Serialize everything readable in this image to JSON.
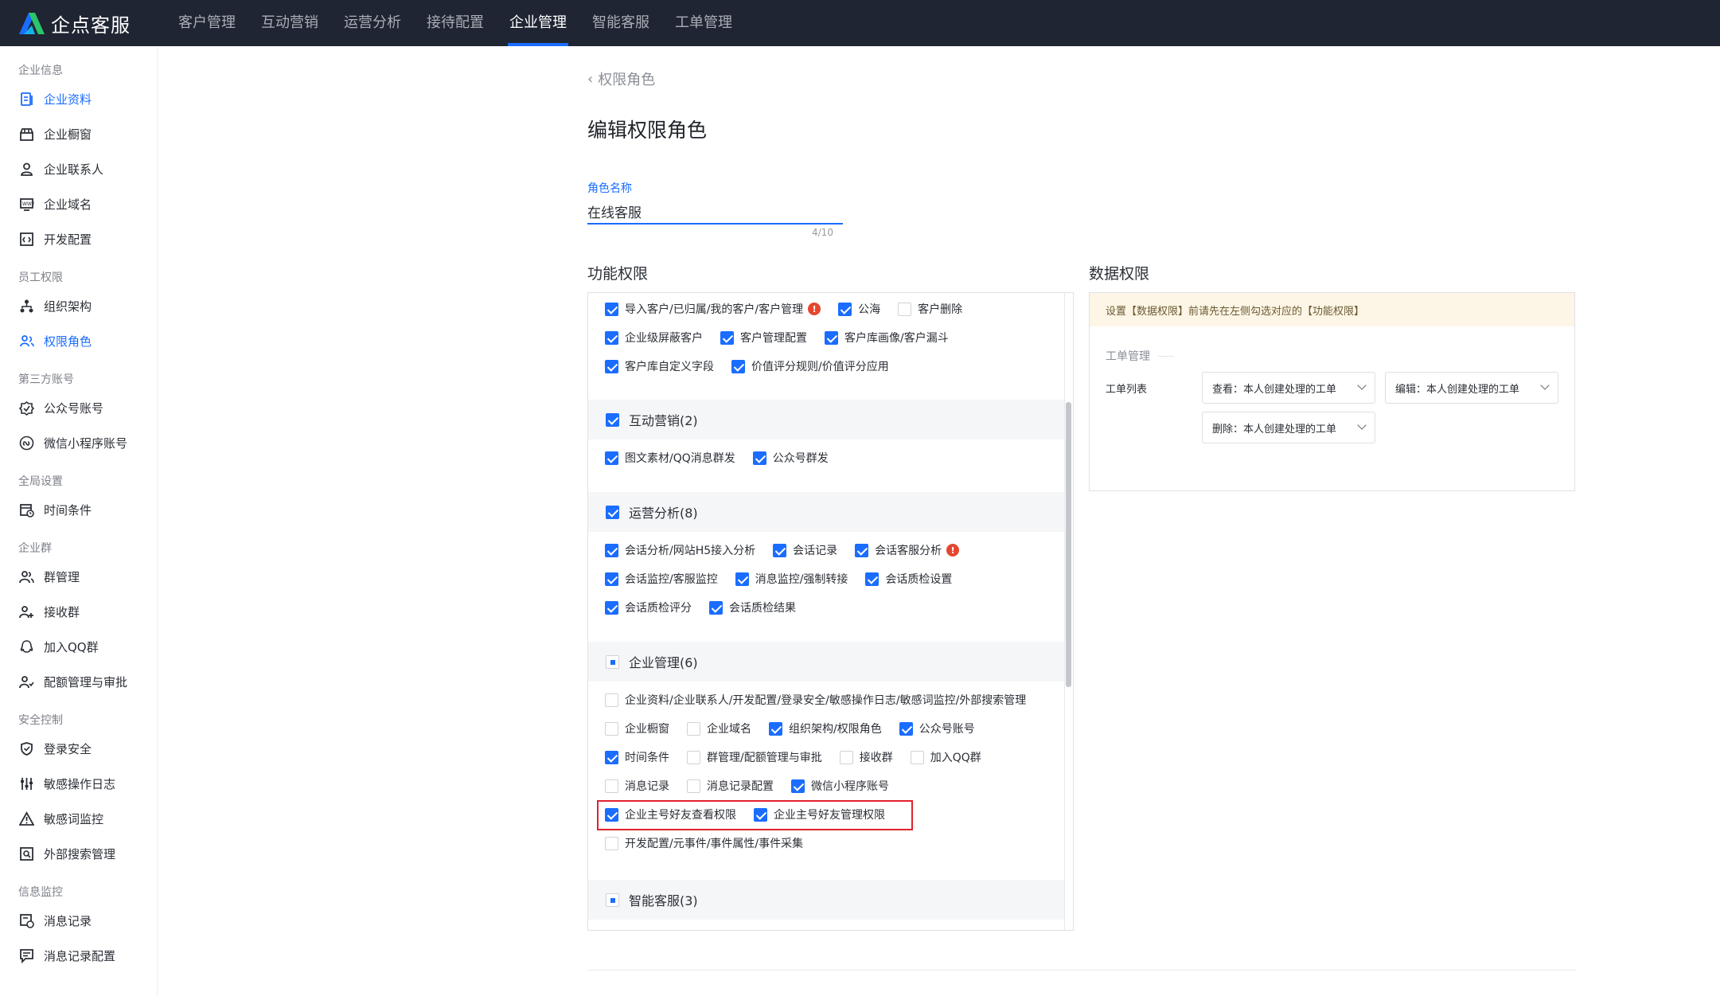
{
  "app": {
    "title": "企点客服"
  },
  "nav": [
    {
      "label": "客户管理",
      "active": false
    },
    {
      "label": "互动营销",
      "active": false
    },
    {
      "label": "运营分析",
      "active": false
    },
    {
      "label": "接待配置",
      "active": false
    },
    {
      "label": "企业管理",
      "active": true
    },
    {
      "label": "智能客服",
      "active": false
    },
    {
      "label": "工单管理",
      "active": false
    }
  ],
  "sidebar": {
    "groups": [
      {
        "title": "企业信息",
        "items": [
          {
            "label": "企业资料",
            "icon": "document-icon",
            "active": true
          },
          {
            "label": "企业橱窗",
            "icon": "store-icon"
          },
          {
            "label": "企业联系人",
            "icon": "contact-icon"
          },
          {
            "label": "企业域名",
            "icon": "domain-icon"
          },
          {
            "label": "开发配置",
            "icon": "code-icon"
          }
        ]
      },
      {
        "title": "员工权限",
        "items": [
          {
            "label": "组织架构",
            "icon": "org-chart-icon"
          },
          {
            "label": "权限角色",
            "icon": "role-icon",
            "active": true
          }
        ]
      },
      {
        "title": "第三方账号",
        "items": [
          {
            "label": "公众号账号",
            "icon": "official-account-icon"
          },
          {
            "label": "微信小程序账号",
            "icon": "mini-program-icon"
          }
        ]
      },
      {
        "title": "全局设置",
        "items": [
          {
            "label": "时间条件",
            "icon": "calendar-icon"
          }
        ]
      },
      {
        "title": "企业群",
        "items": [
          {
            "label": "群管理",
            "icon": "group-icon"
          },
          {
            "label": "接收群",
            "icon": "group-add-icon"
          },
          {
            "label": "加入QQ群",
            "icon": "qq-icon"
          },
          {
            "label": "配额管理与审批",
            "icon": "quota-icon"
          }
        ]
      },
      {
        "title": "安全控制",
        "items": [
          {
            "label": "登录安全",
            "icon": "shield-icon"
          },
          {
            "label": "敏感操作日志",
            "icon": "sliders-icon"
          },
          {
            "label": "敏感词监控",
            "icon": "warning-icon"
          },
          {
            "label": "外部搜索管理",
            "icon": "search-box-icon"
          }
        ]
      },
      {
        "title": "信息监控",
        "items": [
          {
            "label": "消息记录",
            "icon": "message-record-icon"
          },
          {
            "label": "消息记录配置",
            "icon": "message-config-icon"
          }
        ]
      }
    ]
  },
  "main": {
    "back_label": "权限角色",
    "page_title": "编辑权限角色",
    "role_name_label": "角色名称",
    "role_name_value": "在线客服",
    "role_name_count": "4/10",
    "func_title": "功能权限",
    "data_title": "数据权限"
  },
  "func": {
    "top_rows": [
      [
        {
          "label": "导入客户/已归属/我的客户/客户管理",
          "checked": true,
          "warn": true
        },
        {
          "label": "公海",
          "checked": true
        },
        {
          "label": "客户删除",
          "checked": false
        }
      ],
      [
        {
          "label": "企业级屏蔽客户",
          "checked": true
        },
        {
          "label": "客户管理配置",
          "checked": true
        },
        {
          "label": "客户库画像/客户漏斗",
          "checked": true
        }
      ],
      [
        {
          "label": "客户库自定义字段",
          "checked": true
        },
        {
          "label": "价值评分规则/价值评分应用",
          "checked": true
        }
      ]
    ],
    "groups": [
      {
        "title": "互动营销(2)",
        "state": "checked",
        "rows": [
          [
            {
              "label": "图文素材/QQ消息群发",
              "checked": true
            },
            {
              "label": "公众号群发",
              "checked": true
            }
          ]
        ]
      },
      {
        "title": "运营分析(8)",
        "state": "checked",
        "rows": [
          [
            {
              "label": "会话分析/网站H5接入分析",
              "checked": true
            },
            {
              "label": "会话记录",
              "checked": true
            },
            {
              "label": "会话客服分析",
              "checked": true,
              "warn": true
            }
          ],
          [
            {
              "label": "会话监控/客服监控",
              "checked": true
            },
            {
              "label": "消息监控/强制转接",
              "checked": true
            },
            {
              "label": "会话质检设置",
              "checked": true
            }
          ],
          [
            {
              "label": "会话质检评分",
              "checked": true
            },
            {
              "label": "会话质检结果",
              "checked": true
            }
          ]
        ]
      },
      {
        "title": "企业管理(6)",
        "state": "partial",
        "rows": [
          [
            {
              "label": "企业资料/企业联系人/开发配置/登录安全/敏感操作日志/敏感词监控/外部搜索管理",
              "checked": false
            }
          ],
          [
            {
              "label": "企业橱窗",
              "checked": false
            },
            {
              "label": "企业域名",
              "checked": false
            },
            {
              "label": "组织架构/权限角色",
              "checked": true
            },
            {
              "label": "公众号账号",
              "checked": true
            }
          ],
          [
            {
              "label": "时间条件",
              "checked": true
            },
            {
              "label": "群管理/配额管理与审批",
              "checked": false
            },
            {
              "label": "接收群",
              "checked": false
            },
            {
              "label": "加入QQ群",
              "checked": false
            }
          ],
          [
            {
              "label": "消息记录",
              "checked": false
            },
            {
              "label": "消息记录配置",
              "checked": false
            },
            {
              "label": "微信小程序账号",
              "checked": true
            }
          ],
          [
            {
              "label": "企业主号好友查看权限",
              "checked": true
            },
            {
              "label": "企业主号好友管理权限",
              "checked": true
            }
          ],
          [
            {
              "label": "开发配置/元事件/事件属性/事件采集",
              "checked": false
            }
          ]
        ]
      },
      {
        "title": "智能客服(3)",
        "state": "partial",
        "rows": []
      }
    ]
  },
  "data_perm": {
    "notice": "设置【数据权限】前请先在左侧勾选对应的【功能权限】",
    "section": "工单管理",
    "row_label": "工单列表",
    "selects": [
      {
        "prefix": "查看：",
        "value": "本人创建处理的工单"
      },
      {
        "prefix": "编辑：",
        "value": "本人创建处理的工单"
      },
      {
        "prefix": "删除：",
        "value": "本人创建处理的工单"
      }
    ]
  },
  "colors": {
    "accent": "#1a6dff",
    "nav_bg": "#1f2532",
    "highlight": "#e0222d",
    "warn": "#e5462f"
  }
}
